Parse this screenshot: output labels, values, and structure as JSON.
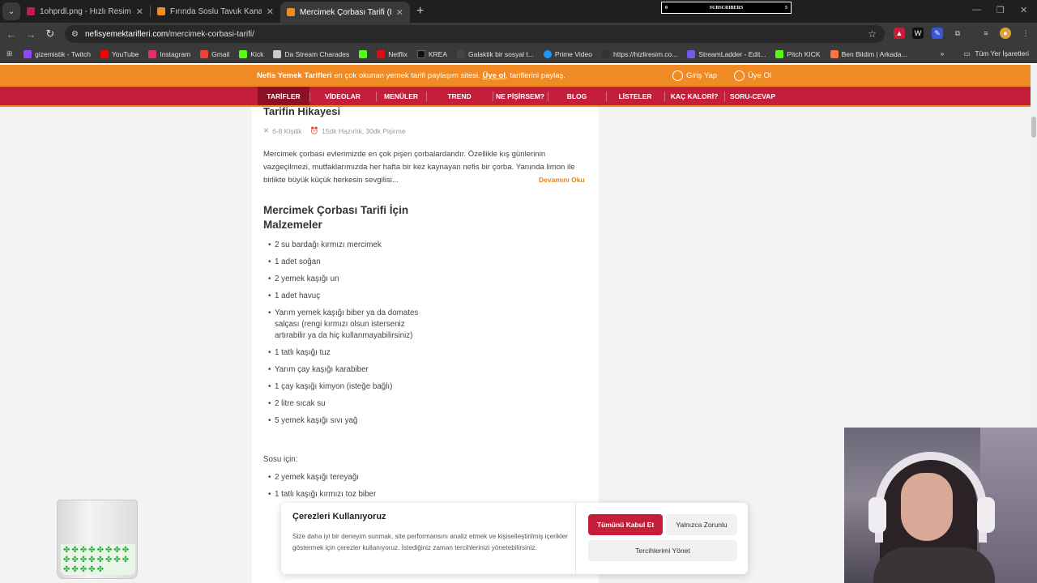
{
  "browser": {
    "tabs": [
      {
        "title": "1ohprdl.png - Hızlı Resim",
        "color": "#c2185b"
      },
      {
        "title": "Fırında Soslu Tavuk Kanat - Nefis",
        "color": "#f08a24"
      },
      {
        "title": "Mercimek Çorbası Tarifi (Lokanta",
        "color": "#f08a24"
      }
    ],
    "subscribers": {
      "left": "0",
      "label": "SUBSCRIBERS",
      "right": "5"
    },
    "url_host": "nefisyemektarifleri.com",
    "url_path": "/mercimek-corbasi-tarifi/",
    "bookmarks": [
      {
        "label": "gizemistik - Twitch",
        "color": "#9146ff"
      },
      {
        "label": "YouTube",
        "color": "#ff0000"
      },
      {
        "label": "Instagram",
        "color": "#e1306c"
      },
      {
        "label": "Gmail",
        "color": "#ea4335"
      },
      {
        "label": "Kick",
        "color": "#53fc18"
      },
      {
        "label": "Da Stream Charades",
        "color": "#cccccc"
      },
      {
        "label": "",
        "color": "#53fc18"
      },
      {
        "label": "Netflix",
        "color": "#e50914"
      },
      {
        "label": "KREA",
        "color": "#222222"
      },
      {
        "label": "Galaktik bir sosyal t...",
        "color": "#444444"
      },
      {
        "label": "Prime Video",
        "color": "#1a98ff"
      },
      {
        "label": "https://hizliresim.co...",
        "color": "#333333"
      },
      {
        "label": "StreamLadder - Edit...",
        "color": "#6c5ce7"
      },
      {
        "label": "Pitch KICK",
        "color": "#53fc18"
      },
      {
        "label": "Ben Bildim | Arkada...",
        "color": "#ff7043"
      }
    ],
    "all_bookmarks": "Tüm Yer İşaretleri"
  },
  "site": {
    "promo_brand": "Nefis Yemek Tarifleri",
    "promo_text": " en çok okunan yemek tarifi paylaşım sitesi. ",
    "promo_link": "Üye ol",
    "promo_tail": ", tariflerini paylaş.",
    "login": "Giriş Yap",
    "signup": "Üye Ol",
    "nav": [
      "TARİFLER",
      "VİDEOLAR",
      "MENÜLER",
      "TREND",
      "NE PİŞİRSEM?",
      "BLOG",
      "LİSTELER",
      "KAÇ KALORİ?",
      "SORU-CEVAP"
    ]
  },
  "recipe": {
    "story_title": "Tarifin Hikayesi",
    "servings": "6-8 Kişilik",
    "time": "15dk Hazırlık, 30dk Pişirme",
    "description": "Mercimek çorbası evlerimizde en çok pişen çorbalardandır. Özellikle kış günlerinin vazgeçilmezi, mutfaklarımızda her hafta bir kez kaynayan nefis bir çorba. Yanında limon ile birlikte büyük küçük herkesin sevgilisi...",
    "read_more": "Devamını Oku",
    "ingredients_title": "Mercimek Çorbası Tarifi İçin Malzemeler",
    "ingredients": [
      "2 su bardağı kırmızı mercimek",
      "1 adet soğan",
      "2 yemek kaşığı un",
      "1 adet havuç",
      "Yarım yemek kaşığı biber ya da domates salçası (rengi kırmızı olsun isterseniz artırabilir ya da hiç kullanmayabilirsiniz)",
      "1 tatlı kaşığı tuz",
      "Yarım çay kaşığı karabiber",
      "1 çay kaşığı kimyon (isteğe bağlı)",
      "2 litre sıcak su",
      "5 yemek kaşığı sıvı yağ"
    ],
    "sauce_title": "Sosu için:",
    "sauce": [
      "2 yemek kaşığı tereyağı",
      "1 tatlı kaşığı kırmızı toz biber"
    ]
  },
  "cookie": {
    "title": "Çerezleri Kullanıyoruz",
    "text": "Size daha iyi bir deneyim sunmak, site performansını analiz etmek ve kişiselleştirilmiş içerikler göstermek için çerezler kullanıyoruz. İstediğiniz zaman tercihlerinizi yönetebilirsiniz.",
    "accept": "Tümünü Kabul Et",
    "only_required": "Yalnızca Zorunlu",
    "manage": "Tercihlerimi Yönet"
  },
  "colors": {
    "brand_orange": "#f08a24",
    "brand_red": "#c41e3a"
  }
}
